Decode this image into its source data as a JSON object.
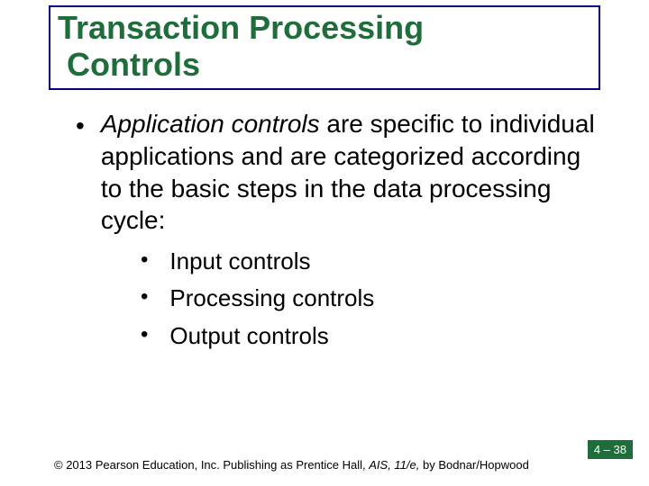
{
  "title": {
    "line1": "Transaction Processing",
    "line2": "Controls"
  },
  "body": {
    "bullet1": {
      "italic_lead": "Application controls",
      "rest": " are specific to individual applications and are categorized according to the basic steps in the data processing cycle:"
    },
    "sub": [
      "Input controls",
      "Processing controls",
      "Output controls"
    ]
  },
  "footer": {
    "copyright_symbol": "©",
    "copyright_text": " 2013 Pearson Education, Inc. Publishing as Prentice Hall, ",
    "book_title": "AIS, 11/e,",
    "authors": " by Bodnar/Hopwood"
  },
  "page_number": "4 – 38"
}
